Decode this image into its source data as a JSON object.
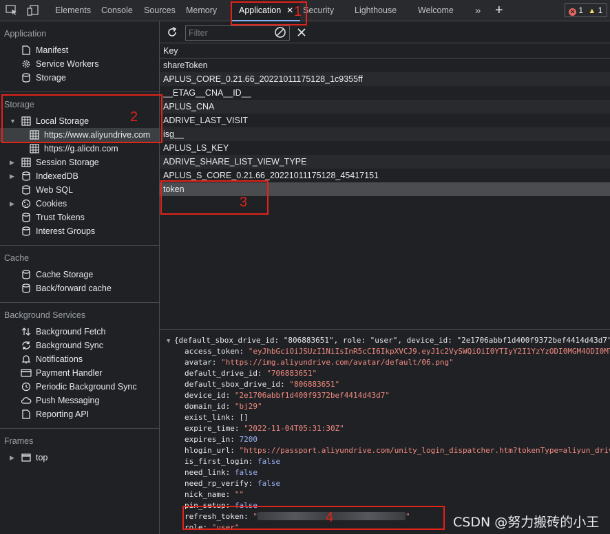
{
  "tabs": [
    "Elements",
    "Console",
    "Sources",
    "Memory",
    "Application",
    "Security",
    "Lighthouse",
    "Welcome"
  ],
  "badges": {
    "errors": "1",
    "warnings": "1"
  },
  "sidebar": {
    "application_title": "Application",
    "application_items": [
      "Manifest",
      "Service Workers",
      "Storage"
    ],
    "storage_title": "Storage",
    "local_storage": "Local Storage",
    "local_origins": [
      "https://www.aliyundrive.com",
      "https://g.alicdn.com"
    ],
    "storage_items": [
      "Session Storage",
      "IndexedDB",
      "Web SQL",
      "Cookies",
      "Trust Tokens",
      "Interest Groups"
    ],
    "cache_title": "Cache",
    "cache_items": [
      "Cache Storage",
      "Back/forward cache"
    ],
    "bg_title": "Background Services",
    "bg_items": [
      "Background Fetch",
      "Background Sync",
      "Notifications",
      "Payment Handler",
      "Periodic Background Sync",
      "Push Messaging",
      "Reporting API"
    ],
    "frames_title": "Frames",
    "frames_item": "top"
  },
  "toolbar": {
    "filter_placeholder": "Filter"
  },
  "table": {
    "header": "Key",
    "rows": [
      "shareToken",
      "APLUS_CORE_0.21.66_20221011175128_1c9355ff",
      "__ETAG__CNA__ID__",
      "APLUS_CNA",
      "ADRIVE_LAST_VISIT",
      "isg__",
      "APLUS_LS_KEY",
      "ADRIVE_SHARE_LIST_VIEW_TYPE",
      "APLUS_S_CORE_0.21.66_20221011175128_45417151",
      "token"
    ]
  },
  "value": {
    "summary": "{default_sbox_drive_id: \"806883651\", role: \"user\", device_id: \"2e1706abbf1d400f9372bef4414d43d7\"",
    "lines": [
      {
        "key": "access_token",
        "val": "\"eyJhbGciOiJSUzI1NiIsInR5cCI6IkpXVCJ9.eyJ1c2VySWQiOiI0YTIyY2I1YzYzODI0MGM4ODI0MT",
        "t": "s"
      },
      {
        "key": "avatar",
        "val": "\"https://img.aliyundrive.com/avatar/default/06.png\"",
        "t": "s"
      },
      {
        "key": "default_drive_id",
        "val": "\"706883651\"",
        "t": "s"
      },
      {
        "key": "default_sbox_drive_id",
        "val": "\"806883651\"",
        "t": "s"
      },
      {
        "key": "device_id",
        "val": "\"2e1706abbf1d400f9372bef4414d43d7\"",
        "t": "s"
      },
      {
        "key": "domain_id",
        "val": "\"bj29\"",
        "t": "s"
      },
      {
        "key": "exist_link",
        "val": "[]",
        "t": "k"
      },
      {
        "key": "expire_time",
        "val": "\"2022-11-04T05:31:30Z\"",
        "t": "s"
      },
      {
        "key": "expires_in",
        "val": "7200",
        "t": "n"
      },
      {
        "key": "hlogin_url",
        "val": "\"https://passport.aliyundrive.com/unity_login_dispatcher.htm?tokenType=aliyun_driv",
        "t": "s"
      },
      {
        "key": "is_first_login",
        "val": "false",
        "t": "b"
      },
      {
        "key": "need_link",
        "val": "false",
        "t": "b"
      },
      {
        "key": "need_rp_verify",
        "val": "false",
        "t": "b"
      },
      {
        "key": "nick_name",
        "val": "\"\"",
        "t": "s"
      },
      {
        "key": "pin_setup",
        "val": "false",
        "t": "b"
      },
      {
        "key": "refresh_token",
        "val": "\"",
        "t": "s"
      },
      {
        "key": "role",
        "val": "\"user\"",
        "t": "s"
      }
    ]
  },
  "annotations": [
    "1",
    "2",
    "3",
    "4"
  ],
  "watermark": "CSDN @努力搬砖的小王"
}
